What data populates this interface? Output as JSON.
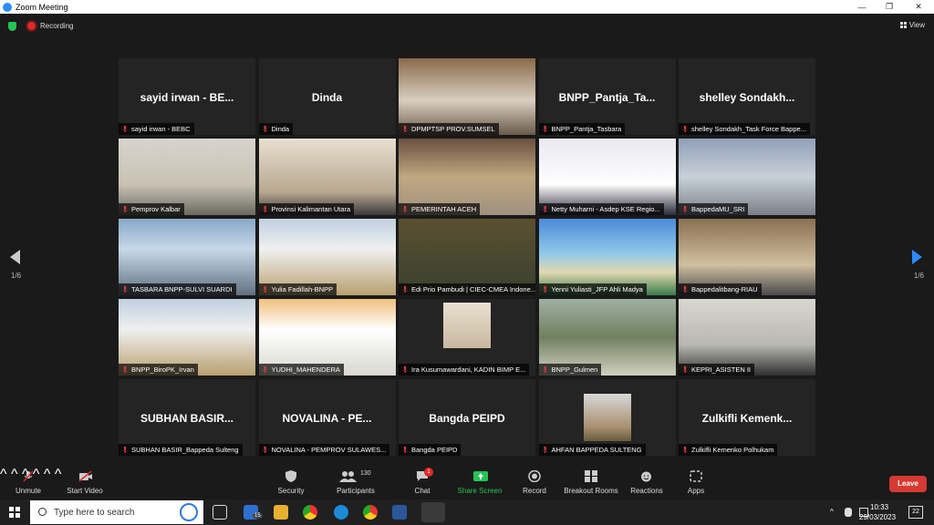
{
  "window": {
    "title": "Zoom Meeting"
  },
  "topbar": {
    "recording_label": "Recording",
    "view_label": "View"
  },
  "pager": {
    "left": "1/6",
    "right": "1/6"
  },
  "tiles": [
    {
      "label": "sayid irwan - BEBC",
      "bigname": "sayid irwan - BE...",
      "kind": "name"
    },
    {
      "label": "Dinda",
      "bigname": "Dinda",
      "kind": "name"
    },
    {
      "label": "DPMPTSP PROV.SUMSEL",
      "bigname": "",
      "kind": "video"
    },
    {
      "label": "BNPP_Pantja_Tasbara",
      "bigname": "BNPP_Pantja_Ta...",
      "kind": "name"
    },
    {
      "label": "shelley Sondakh_Task Force Bappe...",
      "bigname": "shelley Sondakh...",
      "kind": "name"
    },
    {
      "label": "Pemprov Kalbar",
      "bigname": "",
      "kind": "video"
    },
    {
      "label": "Provinsi Kalimantan Utara",
      "bigname": "",
      "kind": "video"
    },
    {
      "label": "PEMERINTAH ACEH",
      "bigname": "",
      "kind": "video"
    },
    {
      "label": "Netty Muharni - Asdep KSE Regio...",
      "bigname": "",
      "kind": "video"
    },
    {
      "label": "BappedaMU_SRI",
      "bigname": "",
      "kind": "video"
    },
    {
      "label": "TASBARA BNPP-SULVI SUARDI",
      "bigname": "",
      "kind": "video"
    },
    {
      "label": "Yulia Fadillah-BNPP",
      "bigname": "",
      "kind": "video"
    },
    {
      "label": "Edi Prio Pambudi | CIEC-CMEA Indone...",
      "bigname": "",
      "kind": "video"
    },
    {
      "label": "Yenni Yuliasti_JFP Ahli Madya",
      "bigname": "",
      "kind": "video"
    },
    {
      "label": "Bappedalitbang-RIAU",
      "bigname": "",
      "kind": "video"
    },
    {
      "label": "BNPP_BiroPK_Irvan",
      "bigname": "",
      "kind": "video"
    },
    {
      "label": "YUDHI_MAHENDERA",
      "bigname": "",
      "kind": "video"
    },
    {
      "label": "Ira Kusumawardani, KADIN BIMP E...",
      "bigname": "",
      "kind": "video"
    },
    {
      "label": "BNPP_Gulmen",
      "bigname": "",
      "kind": "video"
    },
    {
      "label": "KEPRI_ASISTEN II",
      "bigname": "",
      "kind": "video"
    },
    {
      "label": "SUBHAN BASIR_Bappeda Sulteng",
      "bigname": "SUBHAN BASIR...",
      "kind": "name"
    },
    {
      "label": "NOVALINA - PEMPROV SULAWES...",
      "bigname": "NOVALINA - PE...",
      "kind": "name"
    },
    {
      "label": "Bangda PEIPD",
      "bigname": "Bangda PEIPD",
      "kind": "name"
    },
    {
      "label": "AHFAN BAPPEDA SULTENG",
      "bigname": "",
      "kind": "video"
    },
    {
      "label": "Zulkifli Kemenko Polhukam",
      "bigname": "Zulkifli Kemenk...",
      "kind": "name"
    }
  ],
  "toolbar": {
    "unmute": "Unmute",
    "start_video": "Start Video",
    "security": "Security",
    "participants": "Participants",
    "participants_count": "130",
    "chat": "Chat",
    "chat_badge": "1",
    "share_screen": "Share Screen",
    "record": "Record",
    "breakout_rooms": "Breakout Rooms",
    "reactions": "Reactions",
    "apps": "Apps",
    "leave": "Leave"
  },
  "taskbar": {
    "search_placeholder": "Type here to search",
    "mail_badge": "15",
    "time": "10:33",
    "date": "29/03/2023",
    "notifications": "22"
  }
}
